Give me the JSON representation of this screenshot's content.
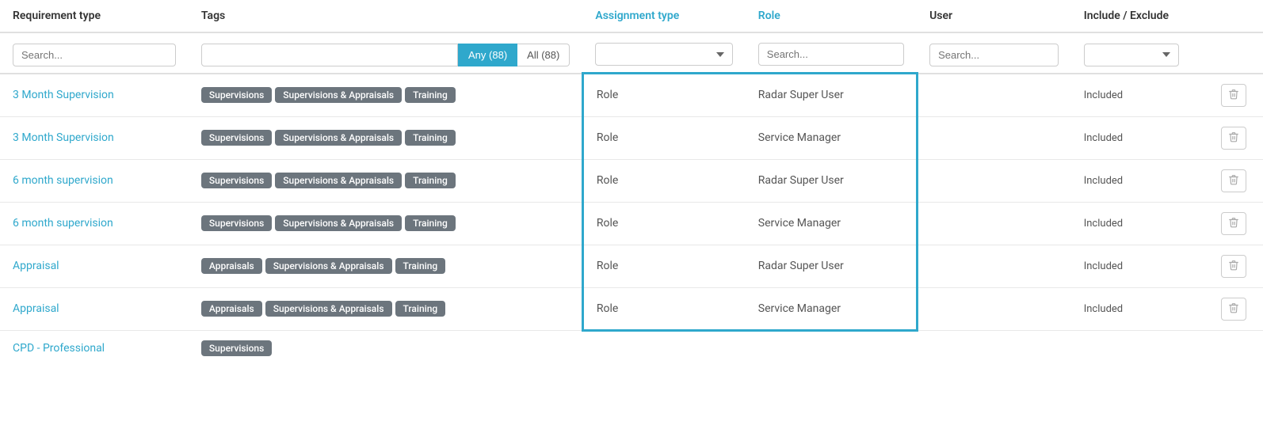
{
  "columns": {
    "req_type": "Requirement type",
    "tags": "Tags",
    "assign_type": "Assignment type",
    "role": "Role",
    "user": "User",
    "include_exclude": "Include / Exclude"
  },
  "filters": {
    "req_search_placeholder": "Search...",
    "tags_any_label": "Any (88)",
    "tags_all_label": "All (88)",
    "assign_placeholder": "",
    "role_search_placeholder": "Search...",
    "user_search_placeholder": "Search...",
    "include_placeholder": ""
  },
  "rows": [
    {
      "req": "3 Month Supervision",
      "tags": [
        "Supervisions",
        "Supervisions & Appraisals",
        "Training"
      ],
      "assign": "Role",
      "role": "Radar Super User",
      "user": "",
      "include": "Included"
    },
    {
      "req": "3 Month Supervision",
      "tags": [
        "Supervisions",
        "Supervisions & Appraisals",
        "Training"
      ],
      "assign": "Role",
      "role": "Service Manager",
      "user": "",
      "include": "Included"
    },
    {
      "req": "6 month supervision",
      "tags": [
        "Supervisions",
        "Supervisions & Appraisals",
        "Training"
      ],
      "assign": "Role",
      "role": "Radar Super User",
      "user": "",
      "include": "Included"
    },
    {
      "req": "6 month supervision",
      "tags": [
        "Supervisions",
        "Supervisions & Appraisals",
        "Training"
      ],
      "assign": "Role",
      "role": "Service Manager",
      "user": "",
      "include": "Included"
    },
    {
      "req": "Appraisal",
      "tags": [
        "Appraisals",
        "Supervisions & Appraisals",
        "Training"
      ],
      "assign": "Role",
      "role": "Radar Super User",
      "user": "",
      "include": "Included"
    },
    {
      "req": "Appraisal",
      "tags": [
        "Appraisals",
        "Supervisions & Appraisals",
        "Training"
      ],
      "assign": "Role",
      "role": "Service Manager",
      "user": "",
      "include": "Included"
    },
    {
      "req": "CPD - Professional",
      "tags": [
        "Supervisions"
      ],
      "assign": "",
      "role": "",
      "user": "",
      "include": ""
    }
  ],
  "delete_icon": "🗑",
  "dropdown_arrow": "▼"
}
